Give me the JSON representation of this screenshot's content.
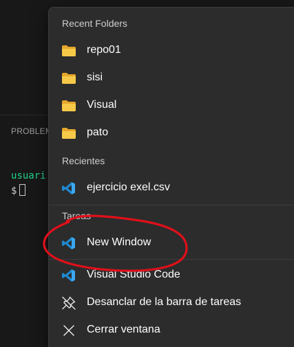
{
  "background": {
    "panel_tab": "PROBLEM",
    "terminal_user": "usuari",
    "terminal_prompt": "$"
  },
  "menu": {
    "sections": {
      "recent_folders": "Recent Folders",
      "recientes": "Recientes",
      "tareas": "Tareas"
    },
    "recent_folders": [
      {
        "label": "repo01",
        "icon": "folder-icon"
      },
      {
        "label": "sisi",
        "icon": "folder-icon"
      },
      {
        "label": "Visual",
        "icon": "folder-icon"
      },
      {
        "label": "pato",
        "icon": "folder-icon"
      }
    ],
    "recientes": [
      {
        "label": "ejercicio exel.csv",
        "icon": "vscode-icon"
      }
    ],
    "tareas": [
      {
        "label": "New Window",
        "icon": "vscode-icon"
      }
    ],
    "actions": [
      {
        "label": "Visual Studio Code",
        "icon": "vscode-icon"
      },
      {
        "label": "Desanclar de la barra de tareas",
        "icon": "unpin-icon"
      },
      {
        "label": "Cerrar ventana",
        "icon": "close-icon"
      }
    ]
  },
  "colors": {
    "menu_bg": "#2c2c2c",
    "folder_yellow": "#f5c242",
    "vscode_blue": "#2a9df4",
    "annotation_red": "#e0101a",
    "terminal_green": "#23d18b"
  }
}
